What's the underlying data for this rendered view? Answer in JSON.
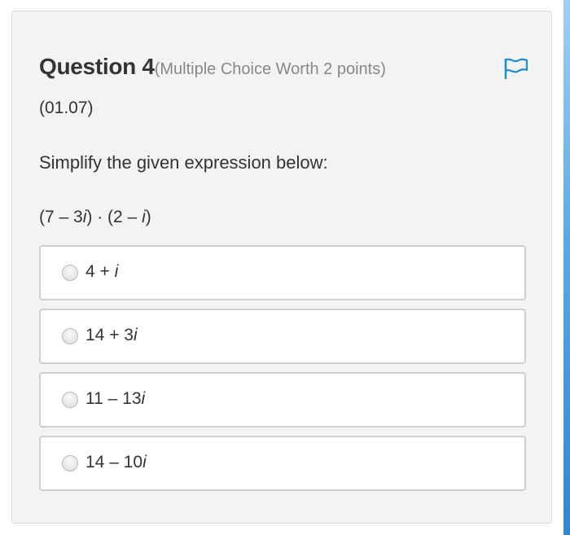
{
  "question": {
    "title": "Question 4",
    "meta": "(Multiple Choice Worth 2 points)",
    "code": "(01.07)",
    "prompt": "Simplify the given expression below:",
    "expression_parts": [
      "(7 – 3",
      "i",
      ") · (2 – ",
      "i",
      ")"
    ]
  },
  "flag_icon": "flag-icon",
  "colors": {
    "accent": "#1a8fc9",
    "card_bg": "#f3f3f3",
    "option_border": "#cfcfcf"
  },
  "options": [
    {
      "prefix": "4 + ",
      "var": "i",
      "selected": false
    },
    {
      "prefix": "14 + 3",
      "var": "i",
      "selected": false
    },
    {
      "prefix": "11 – 13",
      "var": "i",
      "selected": false
    },
    {
      "prefix": "14 – 10",
      "var": "i",
      "selected": false
    }
  ]
}
